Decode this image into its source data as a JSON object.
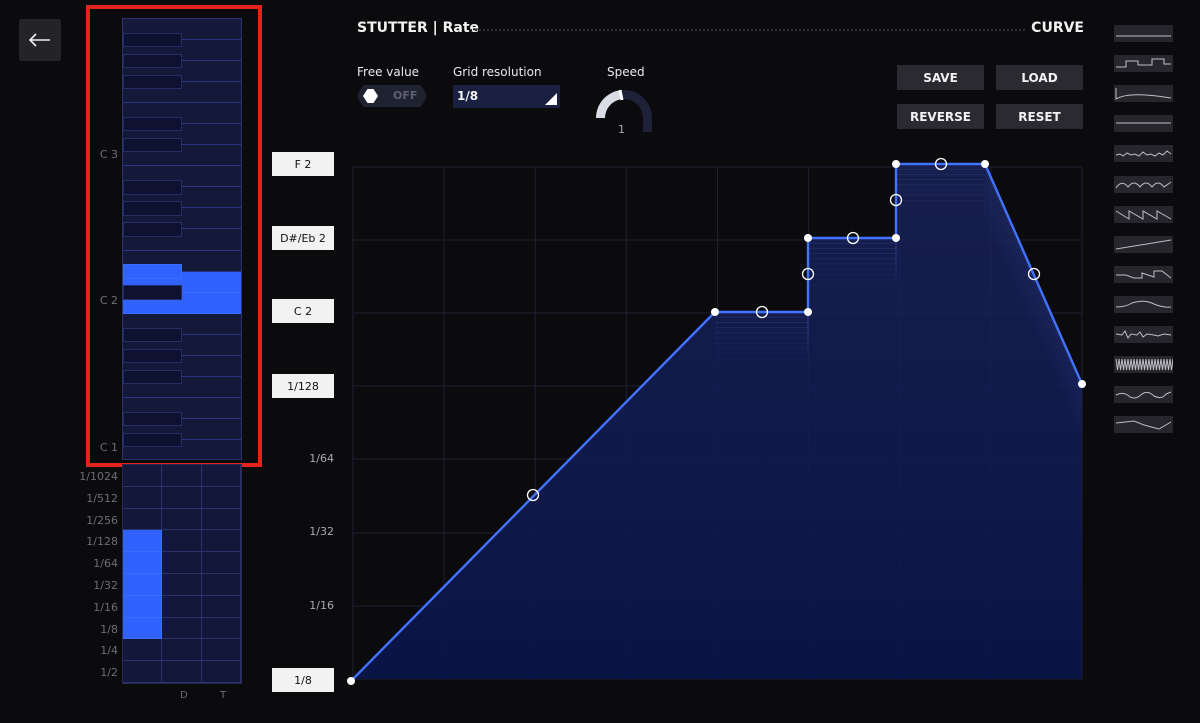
{
  "header": {
    "title": "STUTTER | Rate",
    "mode": "CURVE"
  },
  "controls": {
    "free_value_label": "Free value",
    "free_value_state": "OFF",
    "grid_label": "Grid resolution",
    "grid_value": "1/8",
    "speed_label": "Speed",
    "speed_value": "1"
  },
  "buttons": {
    "save": "SAVE",
    "load": "LOAD",
    "reverse": "REVERSE",
    "reset": "RESET"
  },
  "piano": {
    "labels": [
      "C 3",
      "C 2",
      "C 1"
    ],
    "active_notes": [
      "D#/Eb 2",
      "D 2",
      "C 2"
    ]
  },
  "rate_grid": {
    "labels": [
      "1/1024",
      "1/512",
      "1/256",
      "1/128",
      "1/64",
      "1/32",
      "1/16",
      "1/8",
      "1/4",
      "1/2"
    ],
    "columns": [
      "",
      "D",
      "T"
    ],
    "active_rates": [
      "1/128",
      "1/64",
      "1/32",
      "1/16",
      "1/8"
    ]
  },
  "value_tags": [
    "F 2",
    "D#/Eb 2",
    "C 2",
    "1/128",
    "1/8"
  ],
  "axis_labels": [
    "1/64",
    "1/32",
    "1/16"
  ],
  "presets": [
    "flat",
    "square-steps",
    "decay",
    "flat-high",
    "noise",
    "bumps",
    "saw-down",
    "ramp-up",
    "step-saw",
    "smooth-hump",
    "jitter",
    "dense-sine",
    "wobble",
    "dip"
  ],
  "colors": {
    "accent": "#2f62ff",
    "curve": "#3b6bff",
    "background": "#0b0b0e",
    "highlight": "#e6231a"
  }
}
